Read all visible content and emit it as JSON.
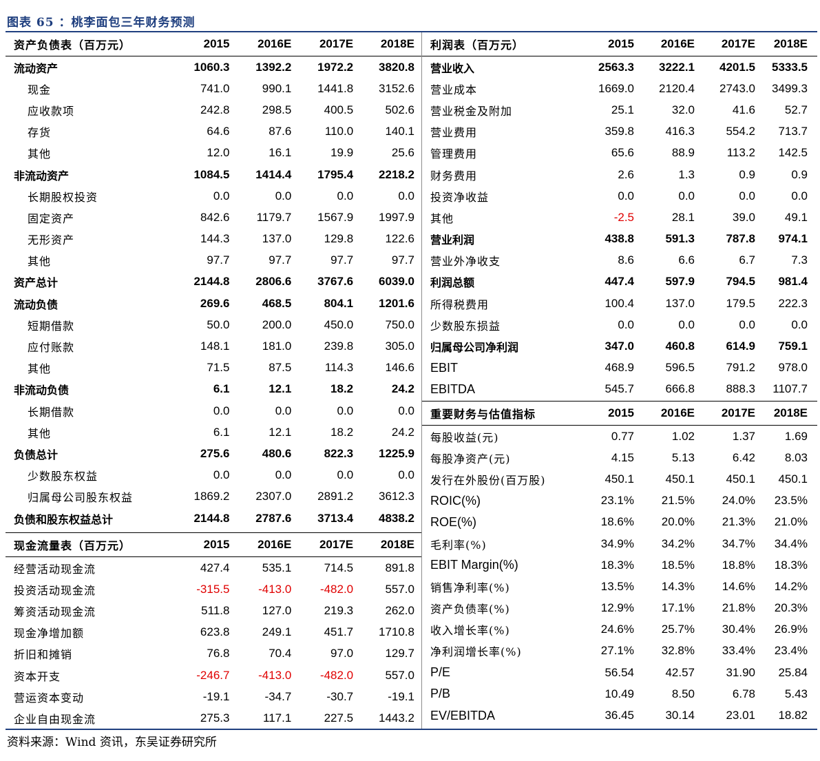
{
  "title": "图表 65 ：桃李面包三年财务预测",
  "source": "资料来源：Wind 资讯，东吴证券研究所",
  "balance_sheet": {
    "header": [
      "资产负债表（百万元）",
      "2015",
      "2016E",
      "2017E",
      "2018E"
    ],
    "rows": [
      {
        "label": "流动资产",
        "type": "cat",
        "values": [
          "1060.3",
          "1392.2",
          "1972.2",
          "3820.8"
        ]
      },
      {
        "label": "现金",
        "type": "sub",
        "values": [
          "741.0",
          "990.1",
          "1441.8",
          "3152.6"
        ]
      },
      {
        "label": "应收款项",
        "type": "sub",
        "values": [
          "242.8",
          "298.5",
          "400.5",
          "502.6"
        ]
      },
      {
        "label": "存货",
        "type": "sub",
        "values": [
          "64.6",
          "87.6",
          "110.0",
          "140.1"
        ]
      },
      {
        "label": "其他",
        "type": "sub",
        "values": [
          "12.0",
          "16.1",
          "19.9",
          "25.6"
        ]
      },
      {
        "label": "非流动资产",
        "type": "cat",
        "values": [
          "1084.5",
          "1414.4",
          "1795.4",
          "2218.2"
        ]
      },
      {
        "label": "长期股权投资",
        "type": "sub2",
        "values": [
          "0.0",
          "0.0",
          "0.0",
          "0.0"
        ]
      },
      {
        "label": "固定资产",
        "type": "sub2",
        "values": [
          "842.6",
          "1179.7",
          "1567.9",
          "1997.9"
        ]
      },
      {
        "label": "无形资产",
        "type": "sub2",
        "values": [
          "144.3",
          "137.0",
          "129.8",
          "122.6"
        ]
      },
      {
        "label": "其他",
        "type": "sub2",
        "values": [
          "97.7",
          "97.7",
          "97.7",
          "97.7"
        ]
      },
      {
        "label": "资产总计",
        "type": "cat",
        "values": [
          "2144.8",
          "2806.6",
          "3767.6",
          "6039.0"
        ]
      },
      {
        "label": "流动负债",
        "type": "cat",
        "values": [
          "269.6",
          "468.5",
          "804.1",
          "1201.6"
        ]
      },
      {
        "label": "短期借款",
        "type": "sub2",
        "values": [
          "50.0",
          "200.0",
          "450.0",
          "750.0"
        ]
      },
      {
        "label": "应付账款",
        "type": "sub2",
        "values": [
          "148.1",
          "181.0",
          "239.8",
          "305.0"
        ]
      },
      {
        "label": "其他",
        "type": "sub2",
        "values": [
          "71.5",
          "87.5",
          "114.3",
          "146.6"
        ]
      },
      {
        "label": "非流动负债",
        "type": "cat",
        "values": [
          "6.1",
          "12.1",
          "18.2",
          "24.2"
        ]
      },
      {
        "label": "长期借款",
        "type": "sub2",
        "values": [
          "0.0",
          "0.0",
          "0.0",
          "0.0"
        ]
      },
      {
        "label": "其他",
        "type": "sub2",
        "values": [
          "6.1",
          "12.1",
          "18.2",
          "24.2"
        ]
      },
      {
        "label": "负债总计",
        "type": "cat",
        "values": [
          "275.6",
          "480.6",
          "822.3",
          "1225.9"
        ]
      },
      {
        "label": "少数股东权益",
        "type": "sub2",
        "values": [
          "0.0",
          "0.0",
          "0.0",
          "0.0"
        ]
      },
      {
        "label": "归属母公司股东权益",
        "type": "sub2",
        "values": [
          "1869.2",
          "2307.0",
          "2891.2",
          "3612.3"
        ]
      },
      {
        "label": "负债和股东权益总计",
        "type": "cat",
        "values": [
          "2144.8",
          "2787.6",
          "3713.4",
          "4838.2"
        ]
      }
    ]
  },
  "cash_flow": {
    "header": [
      "现金流量表（百万元）",
      "2015",
      "2016E",
      "2017E",
      "2018E"
    ],
    "rows": [
      {
        "label": "经营活动现金流",
        "type": "sub",
        "values": [
          "427.4",
          "535.1",
          "714.5",
          "891.8"
        ]
      },
      {
        "label": "投资活动现金流",
        "type": "sub",
        "values": [
          "-315.5",
          "-413.0",
          "-482.0",
          "557.0"
        ]
      },
      {
        "label": "筹资活动现金流",
        "type": "sub",
        "values": [
          "511.8",
          "127.0",
          "219.3",
          "262.0"
        ]
      },
      {
        "label": "现金净增加额",
        "type": "sub",
        "values": [
          "623.8",
          "249.1",
          "451.7",
          "1710.8"
        ]
      },
      {
        "label": "折旧和摊销",
        "type": "sub",
        "values": [
          "76.8",
          "70.4",
          "97.0",
          "129.7"
        ]
      },
      {
        "label": "资本开支",
        "type": "sub",
        "values": [
          "-246.7",
          "-413.0",
          "-482.0",
          "557.0"
        ]
      },
      {
        "label": "营运资本变动",
        "type": "sub",
        "values": [
          "-19.1",
          "-34.7",
          "-30.7",
          "-19.1"
        ]
      },
      {
        "label": "企业自由现金流",
        "type": "sub",
        "values": [
          "275.3",
          "117.1",
          "227.5",
          "1443.2"
        ]
      }
    ],
    "red_values": [
      "-315.5",
      "-413.0",
      "-482.0",
      "-246.7"
    ]
  },
  "income_statement": {
    "header": [
      "利润表（百万元）",
      "2015",
      "2016E",
      "2017E",
      "2018E"
    ],
    "rows": [
      {
        "label": "营业收入",
        "type": "cat",
        "values": [
          "2563.3",
          "3222.1",
          "4201.5",
          "5333.5"
        ]
      },
      {
        "label": "营业成本",
        "type": "sub",
        "values": [
          "1669.0",
          "2120.4",
          "2743.0",
          "3499.3"
        ]
      },
      {
        "label": "营业税金及附加",
        "type": "sub",
        "values": [
          "25.1",
          "32.0",
          "41.6",
          "52.7"
        ]
      },
      {
        "label": "营业费用",
        "type": "sub",
        "values": [
          "359.8",
          "416.3",
          "554.2",
          "713.7"
        ]
      },
      {
        "label": "管理费用",
        "type": "sub",
        "values": [
          "65.6",
          "88.9",
          "113.2",
          "142.5"
        ]
      },
      {
        "label": "财务费用",
        "type": "sub",
        "values": [
          "2.6",
          "1.3",
          "0.9",
          "0.9"
        ]
      },
      {
        "label": "投资净收益",
        "type": "sub",
        "values": [
          "0.0",
          "0.0",
          "0.0",
          "0.0"
        ]
      },
      {
        "label": "其他",
        "type": "sub",
        "values": [
          "-2.5",
          "28.1",
          "39.0",
          "49.1"
        ]
      },
      {
        "label": "营业利润",
        "type": "cat",
        "values": [
          "438.8",
          "591.3",
          "787.8",
          "974.1"
        ]
      },
      {
        "label": "营业外净收支",
        "type": "sub",
        "values": [
          "8.6",
          "6.6",
          "6.7",
          "7.3"
        ]
      },
      {
        "label": "利润总额",
        "type": "cat",
        "values": [
          "447.4",
          "597.9",
          "794.5",
          "981.4"
        ]
      },
      {
        "label": "所得税费用",
        "type": "sub",
        "values": [
          "100.4",
          "137.0",
          "179.5",
          "222.3"
        ]
      },
      {
        "label": "少数股东损益",
        "type": "sub",
        "values": [
          "0.0",
          "0.0",
          "0.0",
          "0.0"
        ]
      },
      {
        "label": "归属母公司净利润",
        "type": "cat",
        "values": [
          "347.0",
          "460.8",
          "614.9",
          "759.1"
        ]
      },
      {
        "label": "EBIT",
        "type": "lat",
        "values": [
          "468.9",
          "596.5",
          "791.2",
          "978.0"
        ]
      },
      {
        "label": "EBITDA",
        "type": "lat",
        "values": [
          "545.7",
          "666.8",
          "888.3",
          "1107.7"
        ]
      }
    ],
    "red_values": [
      "-2.5"
    ]
  },
  "key_metrics": {
    "header": [
      "重要财务与估值指标",
      "2015",
      "2016E",
      "2017E",
      "2018E"
    ],
    "rows": [
      {
        "label": "每股收益(元)",
        "type": "sub",
        "values": [
          "0.77",
          "1.02",
          "1.37",
          "1.69"
        ]
      },
      {
        "label": "每股净资产(元)",
        "type": "sub",
        "values": [
          "4.15",
          "5.13",
          "6.42",
          "8.03"
        ]
      },
      {
        "label": "发行在外股份(百万股)",
        "type": "sub",
        "values": [
          "450.1",
          "450.1",
          "450.1",
          "450.1"
        ]
      },
      {
        "label": "ROIC(%)",
        "type": "lat",
        "values": [
          "23.1%",
          "21.5%",
          "24.0%",
          "23.5%"
        ]
      },
      {
        "label": "ROE(%)",
        "type": "lat",
        "values": [
          "18.6%",
          "20.0%",
          "21.3%",
          "21.0%"
        ]
      },
      {
        "label": "毛利率(%)",
        "type": "sub",
        "values": [
          "34.9%",
          "34.2%",
          "34.7%",
          "34.4%"
        ]
      },
      {
        "label": "EBIT Margin(%)",
        "type": "lat",
        "values": [
          "18.3%",
          "18.5%",
          "18.8%",
          "18.3%"
        ]
      },
      {
        "label": "销售净利率(%)",
        "type": "sub",
        "values": [
          "13.5%",
          "14.3%",
          "14.6%",
          "14.2%"
        ]
      },
      {
        "label": "资产负债率(%)",
        "type": "sub",
        "values": [
          "12.9%",
          "17.1%",
          "21.8%",
          "20.3%"
        ]
      },
      {
        "label": "收入增长率(%)",
        "type": "sub",
        "values": [
          "24.6%",
          "25.7%",
          "30.4%",
          "26.9%"
        ]
      },
      {
        "label": "净利润增长率(%)",
        "type": "sub",
        "values": [
          "27.1%",
          "32.8%",
          "33.4%",
          "23.4%"
        ]
      },
      {
        "label": "P/E",
        "type": "lat",
        "values": [
          "56.54",
          "42.57",
          "31.90",
          "25.84"
        ]
      },
      {
        "label": "P/B",
        "type": "lat",
        "values": [
          "10.49",
          "8.50",
          "6.78",
          "5.43"
        ]
      },
      {
        "label": "EV/EBITDA",
        "type": "lat",
        "values": [
          "36.45",
          "30.14",
          "23.01",
          "18.82"
        ]
      }
    ]
  },
  "colors": {
    "title": "#1f3f7f",
    "negative": "#e00000",
    "rule": "#1f3f7f"
  }
}
